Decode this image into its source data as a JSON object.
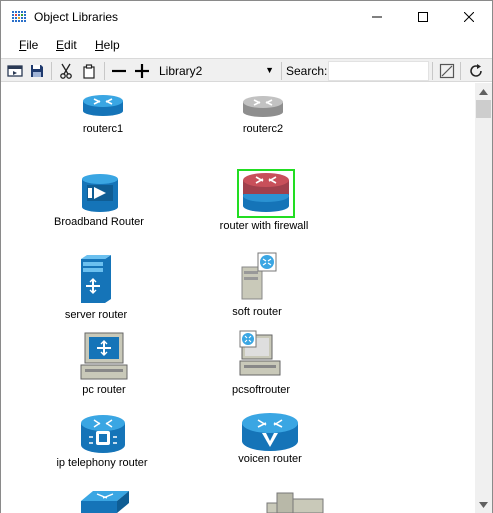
{
  "window": {
    "title": "Object Libraries"
  },
  "menu": {
    "file": "F",
    "file_rest": "ile",
    "edit": "E",
    "edit_rest": "dit",
    "help": "H",
    "help_rest": "elp"
  },
  "toolbar": {
    "library_value": "Library2",
    "search_label": "Search:",
    "search_value": "",
    "icons": [
      "open-icon",
      "save-icon",
      "cut-icon",
      "paste-icon",
      "remove-icon",
      "add-icon",
      "clear-filter-icon",
      "refresh-icon"
    ]
  },
  "objects": [
    {
      "label": "routerc1",
      "icon": "blue-router-icon"
    },
    {
      "label": "routerc2",
      "icon": "gray-router-icon"
    },
    {
      "label": "Broadband Router",
      "icon": "broadband-router-icon"
    },
    {
      "label": "router with firewall",
      "icon": "firewall-router-icon",
      "selected": true
    },
    {
      "label": "server router",
      "icon": "server-router-icon"
    },
    {
      "label": "soft router",
      "icon": "soft-router-icon"
    },
    {
      "label": "pc router",
      "icon": "pc-router-icon"
    },
    {
      "label": "pcsoftrouter",
      "icon": "pc-soft-router-icon"
    },
    {
      "label": "ip telephony router",
      "icon": "ip-telephony-router-icon"
    },
    {
      "label": "voicen router",
      "icon": "voice-router-icon"
    }
  ],
  "colors": {
    "selection": "#22dd22",
    "router_blue": "#1a8fd0",
    "router_red": "#c8505a",
    "router_gray": "#b0b0b0"
  }
}
